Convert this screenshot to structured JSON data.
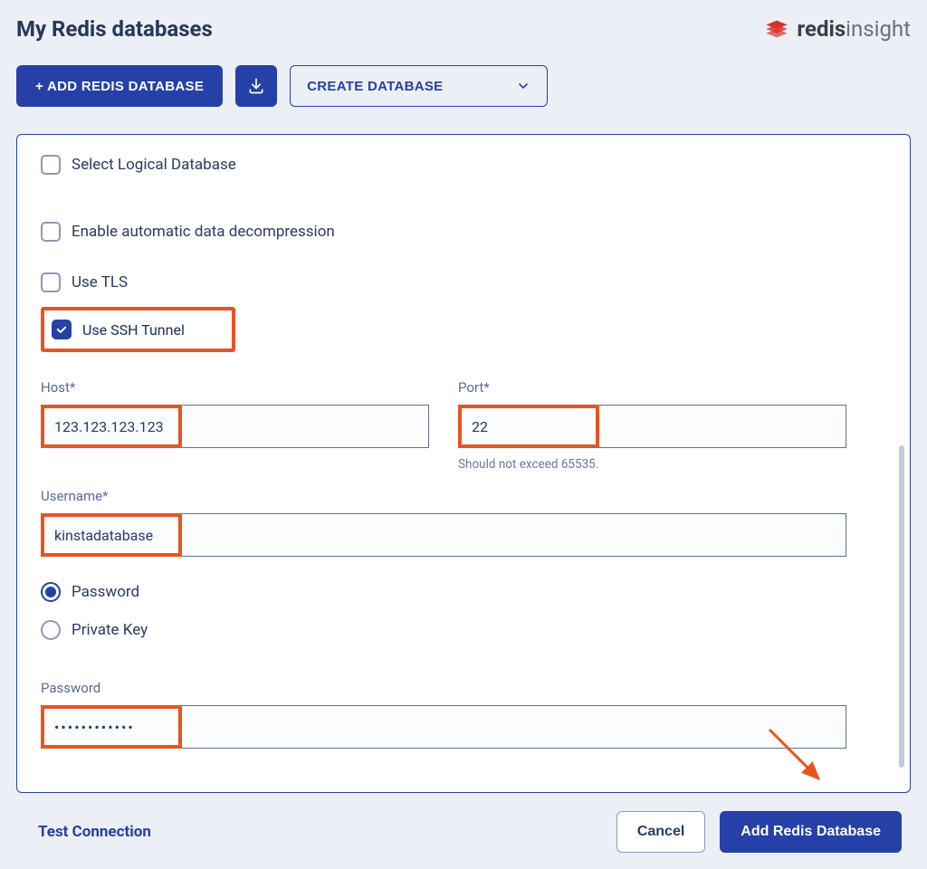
{
  "header": {
    "title": "My Redis databases",
    "brand_bold": "redis",
    "brand_light": "insight"
  },
  "toolbar": {
    "add_label": "+ ADD REDIS DATABASE",
    "create_label": "CREATE DATABASE"
  },
  "form": {
    "checkboxes": {
      "logical": "Select Logical Database",
      "decompress": "Enable automatic data decompression",
      "tls": "Use TLS",
      "ssh": "Use SSH Tunnel"
    },
    "host_label": "Host*",
    "host_value": "123.123.123.123",
    "port_label": "Port*",
    "port_value": "22",
    "port_helper": "Should not exceed 65535.",
    "username_label": "Username*",
    "username_value": "kinstadatabase",
    "auth": {
      "password_radio": "Password",
      "privatekey_radio": "Private Key"
    },
    "password_label": "Password",
    "password_value": "••••••••••••"
  },
  "footer": {
    "test": "Test Connection",
    "cancel": "Cancel",
    "add": "Add Redis Database"
  }
}
